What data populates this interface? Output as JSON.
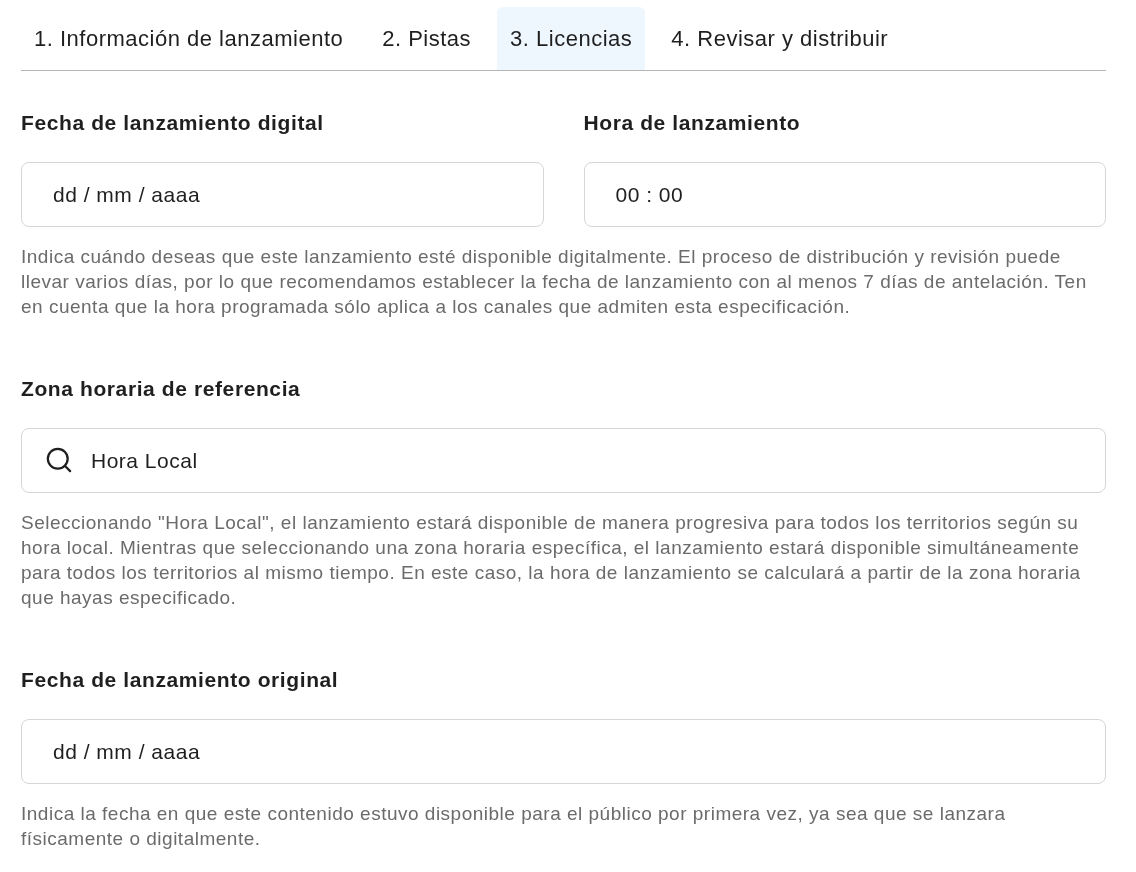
{
  "tabs": [
    {
      "label": "1. Información de lanzamiento",
      "selected": false
    },
    {
      "label": "2. Pistas",
      "selected": false
    },
    {
      "label": "3. Licencias",
      "selected": true
    },
    {
      "label": "4. Revisar y distribuir",
      "selected": false
    }
  ],
  "sections": [
    {
      "fields": [
        {
          "kind": "date",
          "label": "Fecha de lanzamiento digital",
          "placeholder": "dd / mm / aaaa"
        },
        {
          "kind": "time",
          "label": "Hora de lanzamiento",
          "placeholder": "00 : 00"
        }
      ],
      "help": "Indica cuándo deseas que este lanzamiento esté disponible digitalmente. El proceso de distribución y revisión puede llevar varios días, por lo que recomendamos establecer la fecha de lanzamiento con al menos 7 días de antelación. Ten en cuenta que la hora programada sólo aplica a los canales que admiten esta especificación."
    },
    {
      "fields": [
        {
          "kind": "search",
          "label": "Zona horaria de referencia",
          "value": "Hora Local"
        }
      ],
      "help": "Seleccionando \"Hora Local\", el lanzamiento estará disponible de manera progresiva para todos los territorios según su hora local. Mientras que seleccionando una zona horaria específica, el lanzamiento estará disponible simultáneamente para todos los territorios al mismo tiempo. En este caso, la hora de lanzamiento se calculará a partir de la zona horaria que hayas especificado."
    },
    {
      "fields": [
        {
          "kind": "date",
          "label": "Fecha de lanzamiento original",
          "placeholder": "dd / mm / aaaa"
        }
      ],
      "help": "Indica la fecha en que este contenido estuvo disponible para el público por primera vez, ya sea que se lanzara físicamente o digitalmente."
    }
  ]
}
